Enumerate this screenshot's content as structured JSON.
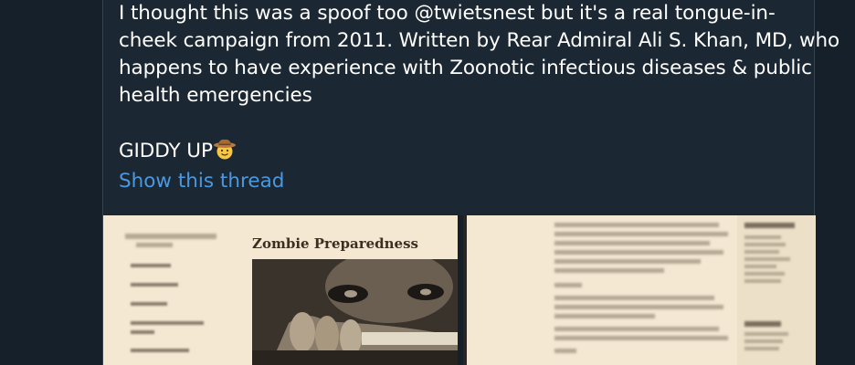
{
  "tweet": {
    "lines": [
      "I thought this was a spoof too @twietsnest  but it's a real tongue-in-",
      "cheek campaign from 2011. Written by Rear Admiral Ali S. Khan, MD, who",
      "happens to have experience with Zoonotic infectious diseases & public",
      "health emergencies"
    ],
    "tagline": "GIDDY UP",
    "tagline_emoji": "cowboy-hat-face-icon",
    "show_thread_label": "Show this thread"
  },
  "media": {
    "left": {
      "doc_title": "Zombie Preparedness"
    }
  },
  "colors": {
    "background": "#15202b",
    "card": "#1b2733",
    "text": "#ffffff",
    "link": "#4a99e0"
  }
}
